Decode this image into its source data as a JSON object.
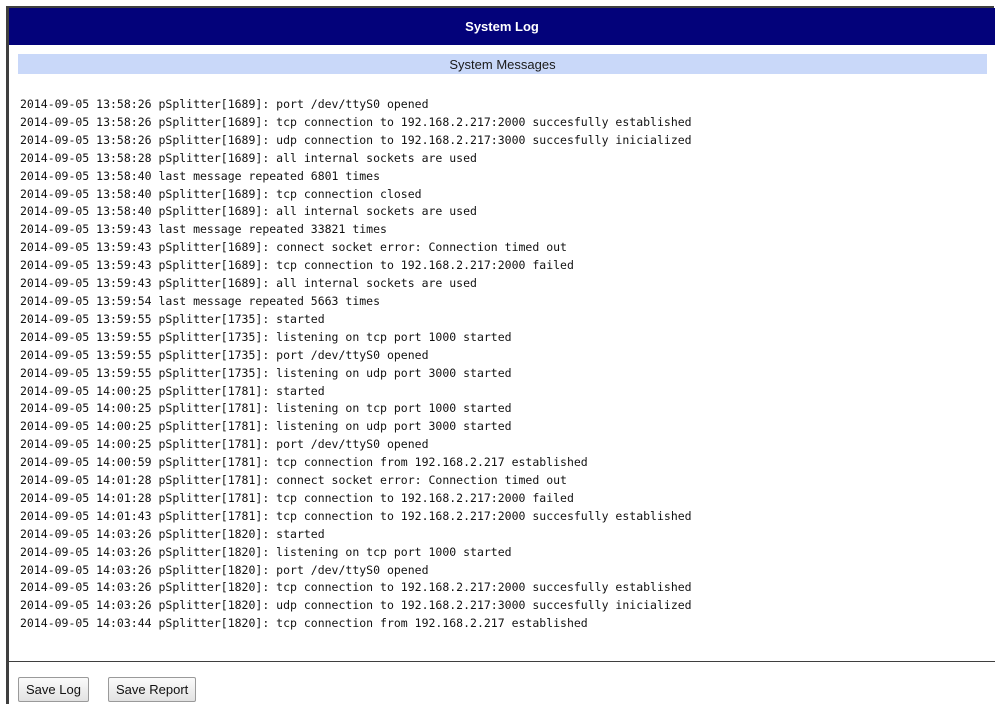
{
  "window": {
    "title": "System Log"
  },
  "section": {
    "title": "System Messages"
  },
  "log": {
    "lines": [
      "2014-09-05 13:58:26 pSplitter[1689]: port /dev/ttyS0 opened",
      "2014-09-05 13:58:26 pSplitter[1689]: tcp connection to 192.168.2.217:2000 succesfully established",
      "2014-09-05 13:58:26 pSplitter[1689]: udp connection to 192.168.2.217:3000 succesfully inicialized",
      "2014-09-05 13:58:28 pSplitter[1689]: all internal sockets are used",
      "2014-09-05 13:58:40 last message repeated 6801 times",
      "2014-09-05 13:58:40 pSplitter[1689]: tcp connection closed",
      "2014-09-05 13:58:40 pSplitter[1689]: all internal sockets are used",
      "2014-09-05 13:59:43 last message repeated 33821 times",
      "2014-09-05 13:59:43 pSplitter[1689]: connect socket error: Connection timed out",
      "2014-09-05 13:59:43 pSplitter[1689]: tcp connection to 192.168.2.217:2000 failed",
      "2014-09-05 13:59:43 pSplitter[1689]: all internal sockets are used",
      "2014-09-05 13:59:54 last message repeated 5663 times",
      "2014-09-05 13:59:55 pSplitter[1735]: started",
      "2014-09-05 13:59:55 pSplitter[1735]: listening on tcp port 1000 started",
      "2014-09-05 13:59:55 pSplitter[1735]: port /dev/ttyS0 opened",
      "2014-09-05 13:59:55 pSplitter[1735]: listening on udp port 3000 started",
      "2014-09-05 14:00:25 pSplitter[1781]: started",
      "2014-09-05 14:00:25 pSplitter[1781]: listening on tcp port 1000 started",
      "2014-09-05 14:00:25 pSplitter[1781]: listening on udp port 3000 started",
      "2014-09-05 14:00:25 pSplitter[1781]: port /dev/ttyS0 opened",
      "2014-09-05 14:00:59 pSplitter[1781]: tcp connection from 192.168.2.217 established",
      "2014-09-05 14:01:28 pSplitter[1781]: connect socket error: Connection timed out",
      "2014-09-05 14:01:28 pSplitter[1781]: tcp connection to 192.168.2.217:2000 failed",
      "2014-09-05 14:01:43 pSplitter[1781]: tcp connection to 192.168.2.217:2000 succesfully established",
      "2014-09-05 14:03:26 pSplitter[1820]: started",
      "2014-09-05 14:03:26 pSplitter[1820]: listening on tcp port 1000 started",
      "2014-09-05 14:03:26 pSplitter[1820]: port /dev/ttyS0 opened",
      "2014-09-05 14:03:26 pSplitter[1820]: tcp connection to 192.168.2.217:2000 succesfully established",
      "2014-09-05 14:03:26 pSplitter[1820]: udp connection to 192.168.2.217:3000 succesfully inicialized",
      "2014-09-05 14:03:44 pSplitter[1820]: tcp connection from 192.168.2.217 established"
    ]
  },
  "buttons": {
    "save_log": "Save Log",
    "save_report": "Save Report"
  },
  "colors": {
    "title_bar": "#03027a",
    "section_bar": "#c9d8f9",
    "frame_border": "#3f3f3f"
  }
}
